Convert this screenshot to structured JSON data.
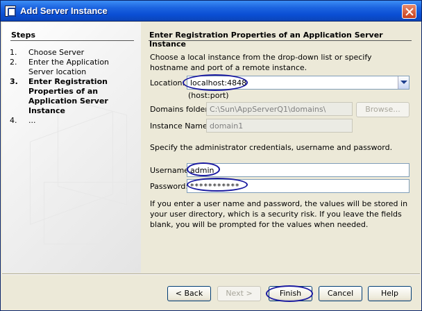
{
  "window": {
    "title": "Add Server Instance"
  },
  "steps": {
    "title": "Steps",
    "items": [
      {
        "num": "1.",
        "label": "Choose Server"
      },
      {
        "num": "2.",
        "label": "Enter the Application Server location"
      },
      {
        "num": "3.",
        "label": "Enter Registration Properties of an Application Server Instance"
      },
      {
        "num": "4.",
        "label": "..."
      }
    ]
  },
  "main": {
    "title": "Enter Registration Properties of an Application Server Instance",
    "intro": "Choose a local instance from the drop-down list or specify hostname and port of a remote instance.",
    "location_label": "Location:",
    "location_value": "localhost:4848",
    "location_hint": "(host:port)",
    "domains_label": "Domains folder:",
    "domains_value": "C:\\Sun\\AppServerQ1\\domains\\",
    "browse_label": "Browse...",
    "instance_label": "Instance Name:",
    "instance_value": "domain1",
    "credentials_text": "Specify the administrator credentials, username and password.",
    "username_label": "Username:",
    "username_value": "admin",
    "password_label": "Password:",
    "password_value": "***********",
    "footer_text": "If you enter a user name and password, the values will be stored in your user directory, which is a security risk. If you leave the fields blank, you will be prompted for the values when needed."
  },
  "buttons": {
    "back": "< Back",
    "next": "Next >",
    "finish": "Finish",
    "cancel": "Cancel",
    "help": "Help"
  }
}
